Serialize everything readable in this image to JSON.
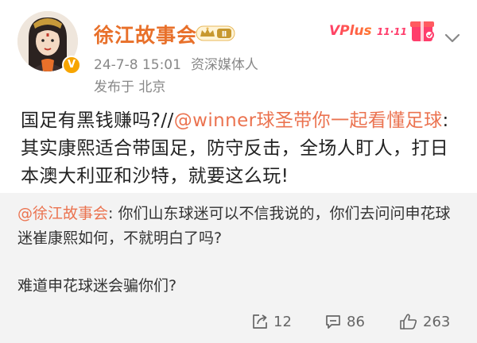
{
  "user": {
    "name": "徐江故事会",
    "level": "Ⅱ",
    "verified_mark": "V",
    "time": "24-7-8 15:01",
    "tag": "资深媒体人",
    "location": "发布于 北京"
  },
  "promo": {
    "label": "VPlus",
    "sub": "11·11"
  },
  "post": {
    "text_before": "国足有黑钱赚吗?//",
    "mention": "@winner球圣带你一起看懂足球",
    "text_after": ":其实康熙适合带国足，防守反击，全场人盯人，打日本澳大利亚和沙特，就要这么玩!"
  },
  "repost": {
    "mention": "@徐江故事会",
    "text": ": 你们山东球迷可以不信我说的，你们去问问申花球迷崔康熙如何，不就明白了吗?",
    "text2": "难道申花球迷会骗你们?"
  },
  "actions": {
    "repost_count": "12",
    "comment_count": "86",
    "like_count": "263"
  },
  "colors": {
    "username": "#e8702a",
    "mention": "#eb7350",
    "repost_bg": "#f3f3f3"
  }
}
